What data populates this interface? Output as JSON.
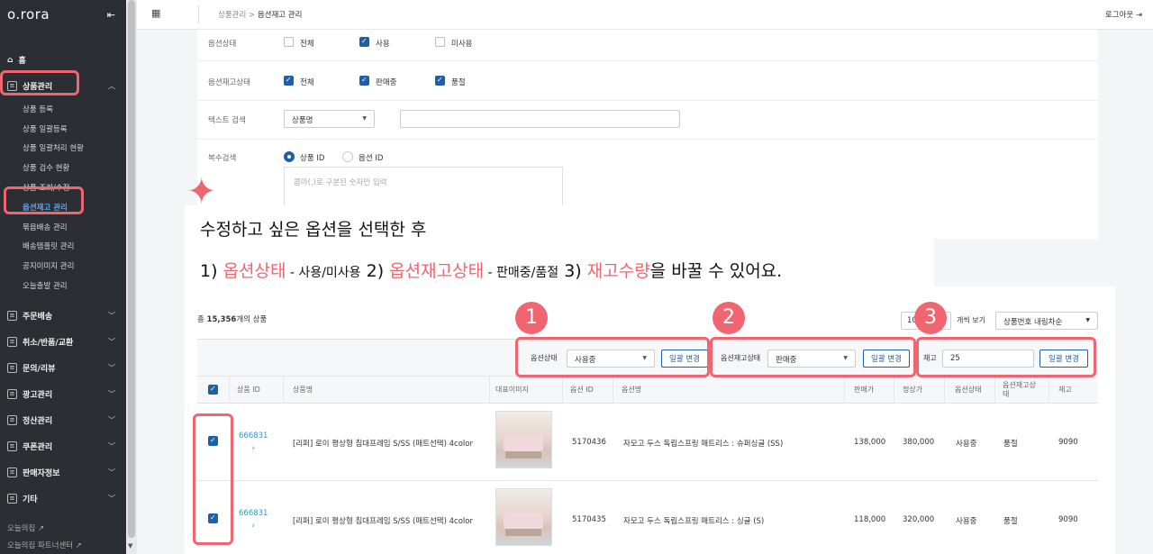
{
  "sidebar": {
    "logo": "o.rora",
    "home": "홈",
    "product_mgmt": "상품관리",
    "sub_items": [
      "상품 등록",
      "상품 일괄등록",
      "상품 일괄처리 현황",
      "상품 검수 현황",
      "상품 조회/수정",
      "옵션재고 관리",
      "묶음배송 관리",
      "배송템플릿 관리",
      "공지이미지 관리",
      "오늘출발 관리"
    ],
    "sections": [
      "주문배송",
      "취소/반품/교환",
      "문의/리뷰",
      "광고관리",
      "정산관리",
      "쿠폰관리",
      "판매자정보",
      "기타"
    ],
    "footer_links": [
      "오늘의집",
      "오늘의집 파트너센터"
    ]
  },
  "topbar": {
    "breadcrumb_parent": "상품관리",
    "breadcrumb_sep": ">",
    "breadcrumb_current": "옵션재고 관리",
    "logout": "로그아웃"
  },
  "filters": {
    "option_status_label": "옵션상태",
    "option_status": [
      "전체",
      "사용",
      "미사용"
    ],
    "stock_status_label": "옵션재고상태",
    "stock_status": [
      "전체",
      "판매중",
      "품절"
    ],
    "text_search_label": "텍스트 검색",
    "text_search_select": "상품명",
    "multi_search_label": "복수검색",
    "multi_search_options": [
      "상품 ID",
      "옵션 ID"
    ],
    "multi_search_placeholder": "콤마(,)로 구분된 숫자만 입력"
  },
  "instruction": {
    "line1": "수정하고 싶은 옵션을 선택한 후",
    "p1_num": "1)",
    "p1_key": "옵션상태",
    "p1_desc": " - 사용/미사용",
    "p2_num": "2)",
    "p2_key": "옵션재고상태",
    "p2_desc": " - 판매중/품절",
    "p3_num": "3)",
    "p3_key": "재고수량",
    "p3_desc": "을 바꿀 수 있어요."
  },
  "results": {
    "count_prefix": "총",
    "count_value": "15,356",
    "count_suffix": "개의 상품",
    "per_page": "10",
    "per_page_label": "개씩 보기",
    "sort": "상품번호 내림차순"
  },
  "bulk": {
    "option_status_label": "옵션상태",
    "option_status_value": "사용중",
    "stock_status_label": "옵션재고상태",
    "stock_status_value": "판매중",
    "stock_label": "재고",
    "stock_value": "25",
    "apply": "일괄 변경"
  },
  "badges": [
    "1",
    "2",
    "3"
  ],
  "table": {
    "headers": [
      "상품 ID",
      "상품명",
      "대표이미지",
      "옵션 ID",
      "옵션명",
      "판매가",
      "정상가",
      "옵션상태",
      "옵션재고상\n태",
      "재고"
    ],
    "rows": [
      {
        "product_id": "666831",
        "name": "[리퍼] 로이 평상형 침대프레임 S/SS (매트선택) 4color",
        "option_id": "5170436",
        "option_name": "자모고 두스 독립스프링 매트리스 : 슈퍼싱글 (SS)",
        "price": "138,000",
        "list_price": "380,000",
        "status": "사용중",
        "stock_status": "품절",
        "stock": "9090"
      },
      {
        "product_id": "666831",
        "name": "[리퍼] 로이 평상형 침대프레임 S/SS (매트선택) 4color",
        "option_id": "5170435",
        "option_name": "자모고 두스 독립스프링 매트리스 : 싱글 (S)",
        "price": "118,000",
        "list_price": "320,000",
        "status": "사용중",
        "stock_status": "품절",
        "stock": "9090"
      }
    ]
  },
  "colors": {
    "accent": "#ef6570",
    "brand_blue": "#1f5fa8",
    "link": "#2b9ec9",
    "sidebar_bg": "#2b2e33"
  }
}
